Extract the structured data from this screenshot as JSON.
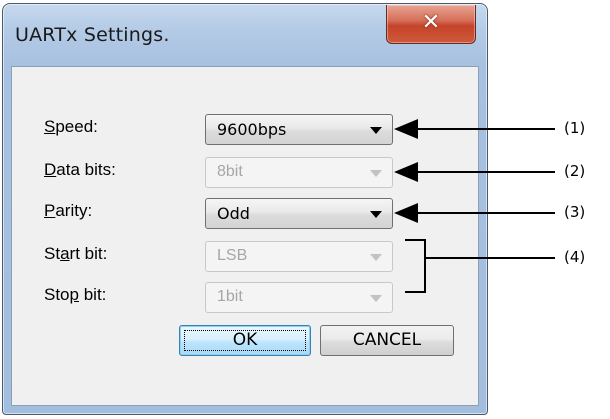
{
  "window": {
    "title": "UARTx Settings."
  },
  "fields": [
    {
      "label_pre": "",
      "label_key": "S",
      "label_post": "peed:",
      "value": "9600bps",
      "enabled": true
    },
    {
      "label_pre": "",
      "label_key": "D",
      "label_post": "ata bits:",
      "value": "8bit",
      "enabled": false
    },
    {
      "label_pre": "",
      "label_key": "P",
      "label_post": "arity:",
      "value": "Odd",
      "enabled": true
    },
    {
      "label_pre": "St",
      "label_key": "a",
      "label_post": "rt bit:",
      "value": "LSB",
      "enabled": false
    },
    {
      "label_pre": "Sto",
      "label_key": "p",
      "label_post": " bit:",
      "value": "1bit",
      "enabled": false
    }
  ],
  "buttons": {
    "ok_label": "OK",
    "cancel_label": "CANCEL"
  },
  "callouts": [
    "(1)",
    "(2)",
    "(3)",
    "(4)"
  ],
  "icons": {
    "close": "close-icon",
    "dropdown": "chevron-down-icon"
  },
  "colors": {
    "frame": "#a7c1e0",
    "close_button": "#c4442a",
    "client": "#f0f0f0",
    "disabled_text": "#a6a6a6",
    "default_button": "#bee6fd"
  }
}
